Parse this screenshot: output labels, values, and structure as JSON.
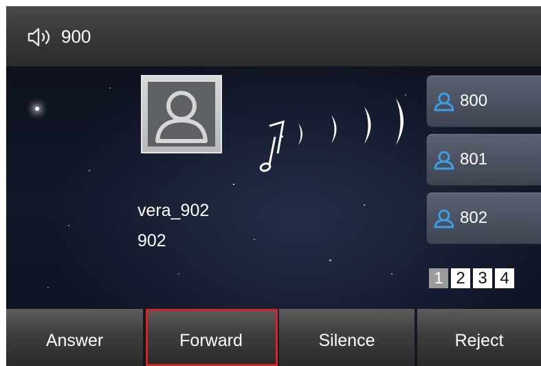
{
  "status_bar": {
    "volume_icon": "speaker-icon",
    "line": "900"
  },
  "caller": {
    "avatar_icon": "contact-avatar-icon",
    "name": "vera_902",
    "number": "902"
  },
  "ringing_icon": "ringing-music-icon",
  "accounts": [
    {
      "label": "800",
      "icon": "person-icon"
    },
    {
      "label": "801",
      "icon": "person-icon"
    },
    {
      "label": "802",
      "icon": "person-icon"
    }
  ],
  "pages": {
    "items": [
      "1",
      "2",
      "3",
      "4"
    ],
    "current": "1"
  },
  "softkeys": {
    "answer": "Answer",
    "forward": "Forward",
    "silence": "Silence",
    "reject": "Reject"
  },
  "colors": {
    "highlight": "#e02020",
    "account_icon": "#3aa0e8"
  }
}
